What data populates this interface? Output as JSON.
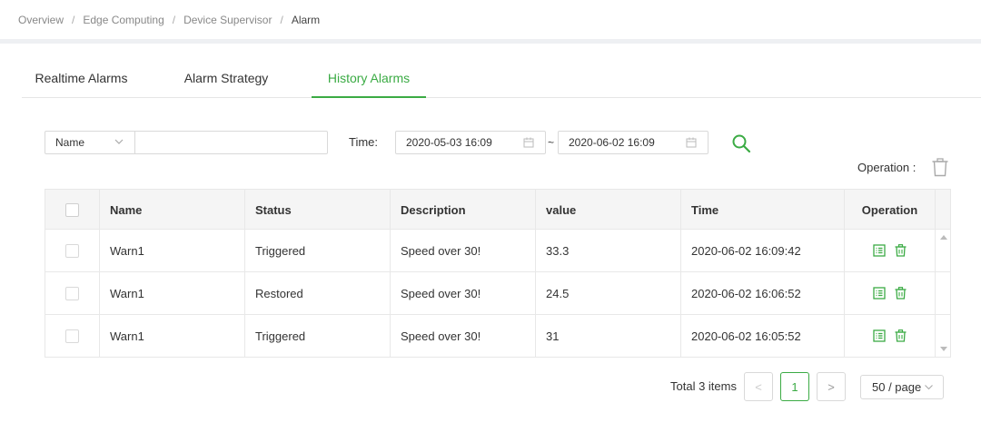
{
  "breadcrumb": {
    "items": [
      "Overview",
      "Edge Computing",
      "Device Supervisor"
    ],
    "current": "Alarm",
    "separator": "/"
  },
  "tabs": [
    {
      "label": "Realtime Alarms",
      "active": false
    },
    {
      "label": "Alarm Strategy",
      "active": false
    },
    {
      "label": "History Alarms",
      "active": true
    }
  ],
  "filter": {
    "field_select": "Name",
    "field_value": "",
    "time_label": "Time:",
    "start_time": "2020-05-03 16:09",
    "range_separator": "~",
    "end_time": "2020-06-02 16:09"
  },
  "operation_label": "Operation :",
  "table": {
    "columns": [
      "Name",
      "Status",
      "Description",
      "value",
      "Time",
      "Operation"
    ],
    "rows": [
      {
        "name": "Warn1",
        "status": "Triggered",
        "description": "Speed over 30!",
        "value": "33.3",
        "time": "2020-06-02 16:09:42"
      },
      {
        "name": "Warn1",
        "status": "Restored",
        "description": "Speed over 30!",
        "value": "24.5",
        "time": "2020-06-02 16:06:52"
      },
      {
        "name": "Warn1",
        "status": "Triggered",
        "description": "Speed over 30!",
        "value": "31",
        "time": "2020-06-02 16:05:52"
      }
    ]
  },
  "pagination": {
    "total_text": "Total 3 items",
    "prev": "<",
    "current_page": "1",
    "next": ">",
    "page_size": "50 / page"
  },
  "colors": {
    "accent": "#3bab44",
    "border": "#d9d9d9",
    "header_bg": "#f5f5f5"
  },
  "icons": [
    "chevron-down-icon",
    "calendar-icon",
    "search-icon",
    "trash-icon",
    "detail-icon",
    "scroll-up-icon",
    "scroll-down-icon"
  ]
}
